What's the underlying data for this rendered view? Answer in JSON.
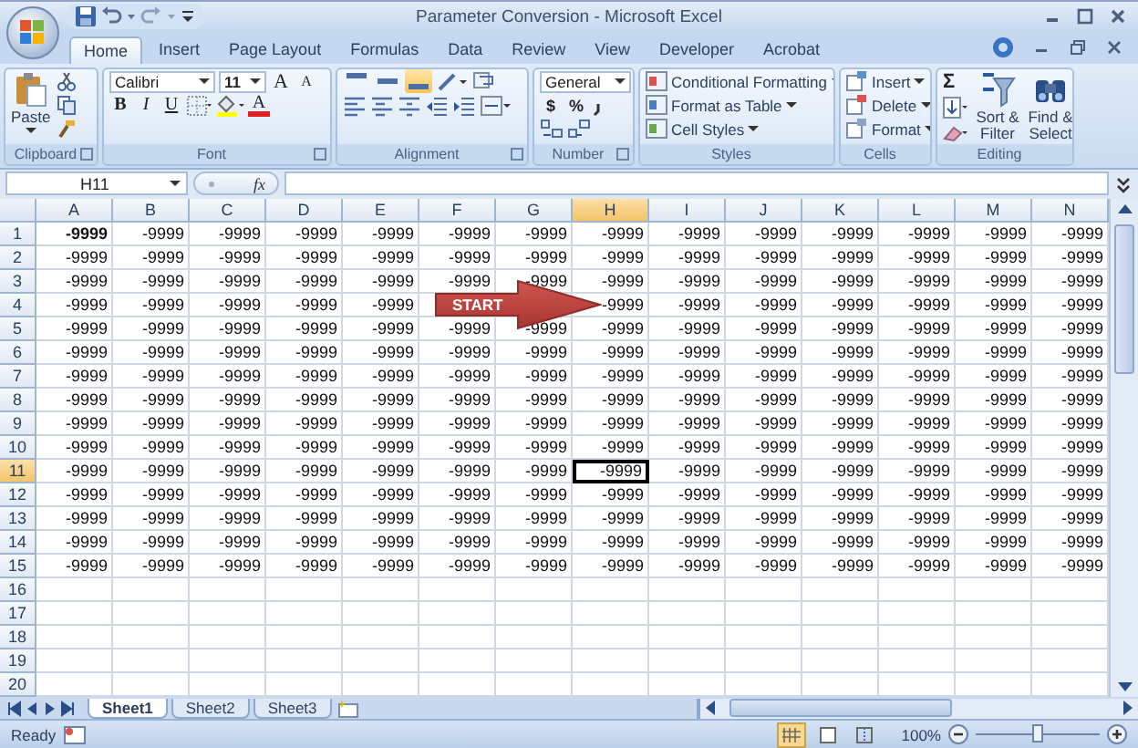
{
  "window": {
    "title": "Parameter Conversion - Microsoft Excel"
  },
  "tabs": [
    {
      "label": "Home",
      "selected": true
    },
    {
      "label": "Insert",
      "selected": false
    },
    {
      "label": "Page Layout",
      "selected": false
    },
    {
      "label": "Formulas",
      "selected": false
    },
    {
      "label": "Data",
      "selected": false
    },
    {
      "label": "Review",
      "selected": false
    },
    {
      "label": "View",
      "selected": false
    },
    {
      "label": "Developer",
      "selected": false
    },
    {
      "label": "Acrobat",
      "selected": false
    }
  ],
  "ribbon": {
    "clipboard": {
      "label": "Clipboard",
      "paste": "Paste"
    },
    "font": {
      "label": "Font",
      "face": "Calibri",
      "size": "11",
      "grow": "A",
      "shrink": "A",
      "bold": "B",
      "italic": "I",
      "underline": "U",
      "text_color": "A"
    },
    "alignment": {
      "label": "Alignment",
      "vertical": [
        {
          "kind": "top",
          "selected": false
        },
        {
          "kind": "middle",
          "selected": false
        },
        {
          "kind": "bottom",
          "selected": true
        }
      ]
    },
    "number": {
      "label": "Number",
      "format": "General",
      "currency": "$",
      "percent": "%"
    },
    "styles": {
      "label": "Styles",
      "items": [
        "Conditional Formatting",
        "Format as Table",
        "Cell Styles"
      ]
    },
    "cells": {
      "label": "Cells",
      "items": [
        "Insert",
        "Delete",
        "Format"
      ]
    },
    "editing": {
      "label": "Editing",
      "sum": "Σ",
      "sort": "Sort & Filter",
      "find": "Find & Select"
    }
  },
  "formula_bar": {
    "name_box": "H11",
    "function": "fx"
  },
  "columns": [
    {
      "label": "A",
      "selected": false
    },
    {
      "label": "B",
      "selected": false
    },
    {
      "label": "C",
      "selected": false
    },
    {
      "label": "D",
      "selected": false
    },
    {
      "label": "E",
      "selected": false
    },
    {
      "label": "F",
      "selected": false
    },
    {
      "label": "G",
      "selected": false
    },
    {
      "label": "H",
      "selected": true
    },
    {
      "label": "I",
      "selected": false
    },
    {
      "label": "J",
      "selected": false
    },
    {
      "label": "K",
      "selected": false
    },
    {
      "label": "L",
      "selected": false
    },
    {
      "label": "M",
      "selected": false
    },
    {
      "label": "N",
      "selected": false
    }
  ],
  "rows": [
    {
      "label": "1",
      "selected": false,
      "cells": [
        {
          "text": "-9999",
          "bold": true
        },
        "-9999",
        "-9999",
        "-9999",
        "-9999",
        "-9999",
        "-9999",
        "-9999",
        "-9999",
        "-9999",
        "-9999",
        "-9999",
        "-9999",
        "-9999"
      ]
    },
    {
      "label": "2",
      "selected": false,
      "cells": [
        "-9999",
        "-9999",
        "-9999",
        "-9999",
        "-9999",
        "-9999",
        "-9999",
        "-9999",
        "-9999",
        "-9999",
        "-9999",
        "-9999",
        "-9999",
        "-9999"
      ]
    },
    {
      "label": "3",
      "selected": false,
      "cells": [
        "-9999",
        "-9999",
        "-9999",
        "-9999",
        "-9999",
        "-9999",
        "-9999",
        "-9999",
        "-9999",
        "-9999",
        "-9999",
        "-9999",
        "-9999",
        "-9999"
      ]
    },
    {
      "label": "4",
      "selected": false,
      "cells": [
        "-9999",
        "-9999",
        "-9999",
        "-9999",
        "-9999",
        null,
        null,
        "-9999",
        "-9999",
        "-9999",
        "-9999",
        "-9999",
        "-9999",
        "-9999"
      ]
    },
    {
      "label": "5",
      "selected": false,
      "cells": [
        "-9999",
        "-9999",
        "-9999",
        "-9999",
        "-9999",
        "-9999",
        "-9999",
        "-9999",
        "-9999",
        "-9999",
        "-9999",
        "-9999",
        "-9999",
        "-9999"
      ]
    },
    {
      "label": "6",
      "selected": false,
      "cells": [
        "-9999",
        "-9999",
        "-9999",
        "-9999",
        "-9999",
        "-9999",
        "-9999",
        "-9999",
        "-9999",
        "-9999",
        "-9999",
        "-9999",
        "-9999",
        "-9999"
      ]
    },
    {
      "label": "7",
      "selected": false,
      "cells": [
        "-9999",
        "-9999",
        "-9999",
        "-9999",
        "-9999",
        "-9999",
        "-9999",
        "-9999",
        "-9999",
        "-9999",
        "-9999",
        "-9999",
        "-9999",
        "-9999"
      ]
    },
    {
      "label": "8",
      "selected": false,
      "cells": [
        "-9999",
        "-9999",
        "-9999",
        "-9999",
        "-9999",
        "-9999",
        "-9999",
        "-9999",
        "-9999",
        "-9999",
        "-9999",
        "-9999",
        "-9999",
        "-9999"
      ]
    },
    {
      "label": "9",
      "selected": false,
      "cells": [
        "-9999",
        "-9999",
        "-9999",
        "-9999",
        "-9999",
        "-9999",
        "-9999",
        "-9999",
        "-9999",
        "-9999",
        "-9999",
        "-9999",
        "-9999",
        "-9999"
      ]
    },
    {
      "label": "10",
      "selected": false,
      "cells": [
        "-9999",
        "-9999",
        "-9999",
        "-9999",
        "-9999",
        "-9999",
        "-9999",
        "-9999",
        "-9999",
        "-9999",
        "-9999",
        "-9999",
        "-9999",
        "-9999"
      ]
    },
    {
      "label": "11",
      "selected": true,
      "cells": [
        "-9999",
        "-9999",
        "-9999",
        "-9999",
        "-9999",
        "-9999",
        "-9999",
        "-9999",
        "-9999",
        "-9999",
        "-9999",
        "-9999",
        "-9999",
        "-9999"
      ]
    },
    {
      "label": "12",
      "selected": false,
      "cells": [
        "-9999",
        "-9999",
        "-9999",
        "-9999",
        "-9999",
        "-9999",
        "-9999",
        "-9999",
        "-9999",
        "-9999",
        "-9999",
        "-9999",
        "-9999",
        "-9999"
      ]
    },
    {
      "label": "13",
      "selected": false,
      "cells": [
        "-9999",
        "-9999",
        "-9999",
        "-9999",
        "-9999",
        "-9999",
        "-9999",
        "-9999",
        "-9999",
        "-9999",
        "-9999",
        "-9999",
        "-9999",
        "-9999"
      ]
    },
    {
      "label": "14",
      "selected": false,
      "cells": [
        "-9999",
        "-9999",
        "-9999",
        "-9999",
        "-9999",
        "-9999",
        "-9999",
        "-9999",
        "-9999",
        "-9999",
        "-9999",
        "-9999",
        "-9999",
        "-9999"
      ]
    },
    {
      "label": "15",
      "selected": false,
      "cells": [
        "-9999",
        "-9999",
        "-9999",
        "-9999",
        "-9999",
        "-9999",
        "-9999",
        "-9999",
        "-9999",
        "-9999",
        "-9999",
        "-9999",
        "-9999",
        "-9999"
      ]
    },
    {
      "label": "16",
      "selected": false
    },
    {
      "label": "17",
      "selected": false
    },
    {
      "label": "18",
      "selected": false
    },
    {
      "label": "19",
      "selected": false
    },
    {
      "label": "20",
      "selected": false
    }
  ],
  "callout": {
    "label": "START"
  },
  "sheets": [
    {
      "label": "Sheet1",
      "selected": true
    },
    {
      "label": "Sheet2",
      "selected": false
    },
    {
      "label": "Sheet3",
      "selected": false
    }
  ],
  "status_bar": {
    "status": "Ready",
    "views": [
      {
        "kind": "normal",
        "selected": true
      },
      {
        "kind": "page-layout",
        "selected": false
      },
      {
        "kind": "page-break",
        "selected": false
      }
    ],
    "zoom": "100%",
    "zoom_slider": {
      "level": 0.5
    }
  }
}
